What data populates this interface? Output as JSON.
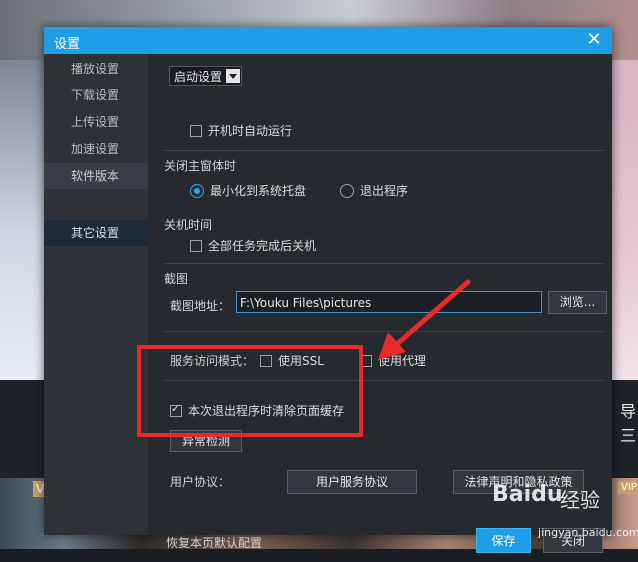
{
  "dialog": {
    "title": "设置",
    "close_icon": "close-icon"
  },
  "sidebar": {
    "items": [
      {
        "label": "播放设置"
      },
      {
        "label": "下载设置"
      },
      {
        "label": "上传设置"
      },
      {
        "label": "加速设置"
      },
      {
        "label": "软件版本"
      },
      {
        "label": "其它设置"
      }
    ]
  },
  "startup": {
    "select_value": "启动设置",
    "autorun_label": "开机时自动运行"
  },
  "close_main": {
    "heading": "关闭主窗体时",
    "option_minimize": "最小化到系统托盘",
    "option_exit": "退出程序"
  },
  "shutdown": {
    "heading": "关机时间",
    "option": "全部任务完成后关机"
  },
  "screenshot": {
    "heading": "截图",
    "path_label": "截图地址：",
    "path_value": "F:\\Youku Files\\pictures",
    "browse_label": "浏览..."
  },
  "service": {
    "mode_label": "服务访问模式：",
    "ssl_label": "使用SSL",
    "proxy_label": "使用代理"
  },
  "cache": {
    "clear_label": "本次退出程序时清除页面缓存",
    "detect_button": "异常检测"
  },
  "agreement": {
    "label": "用户协议：",
    "service_button": "用户服务协议",
    "privacy_button": "法律声明和隐私政策"
  },
  "footer": {
    "restore_label": "恢复本页默认配置",
    "save_label": "保存",
    "cancel_label": "关闭"
  },
  "background": {
    "badge_left": "V",
    "badge_right": "VIP",
    "right_text": "导三"
  },
  "watermark": {
    "logo": "Baidu",
    "logo_cn": "经验",
    "site": "jingyan.baidu.com"
  },
  "colors": {
    "accent": "#1f9ee8",
    "annotation": "#e82a2a"
  }
}
